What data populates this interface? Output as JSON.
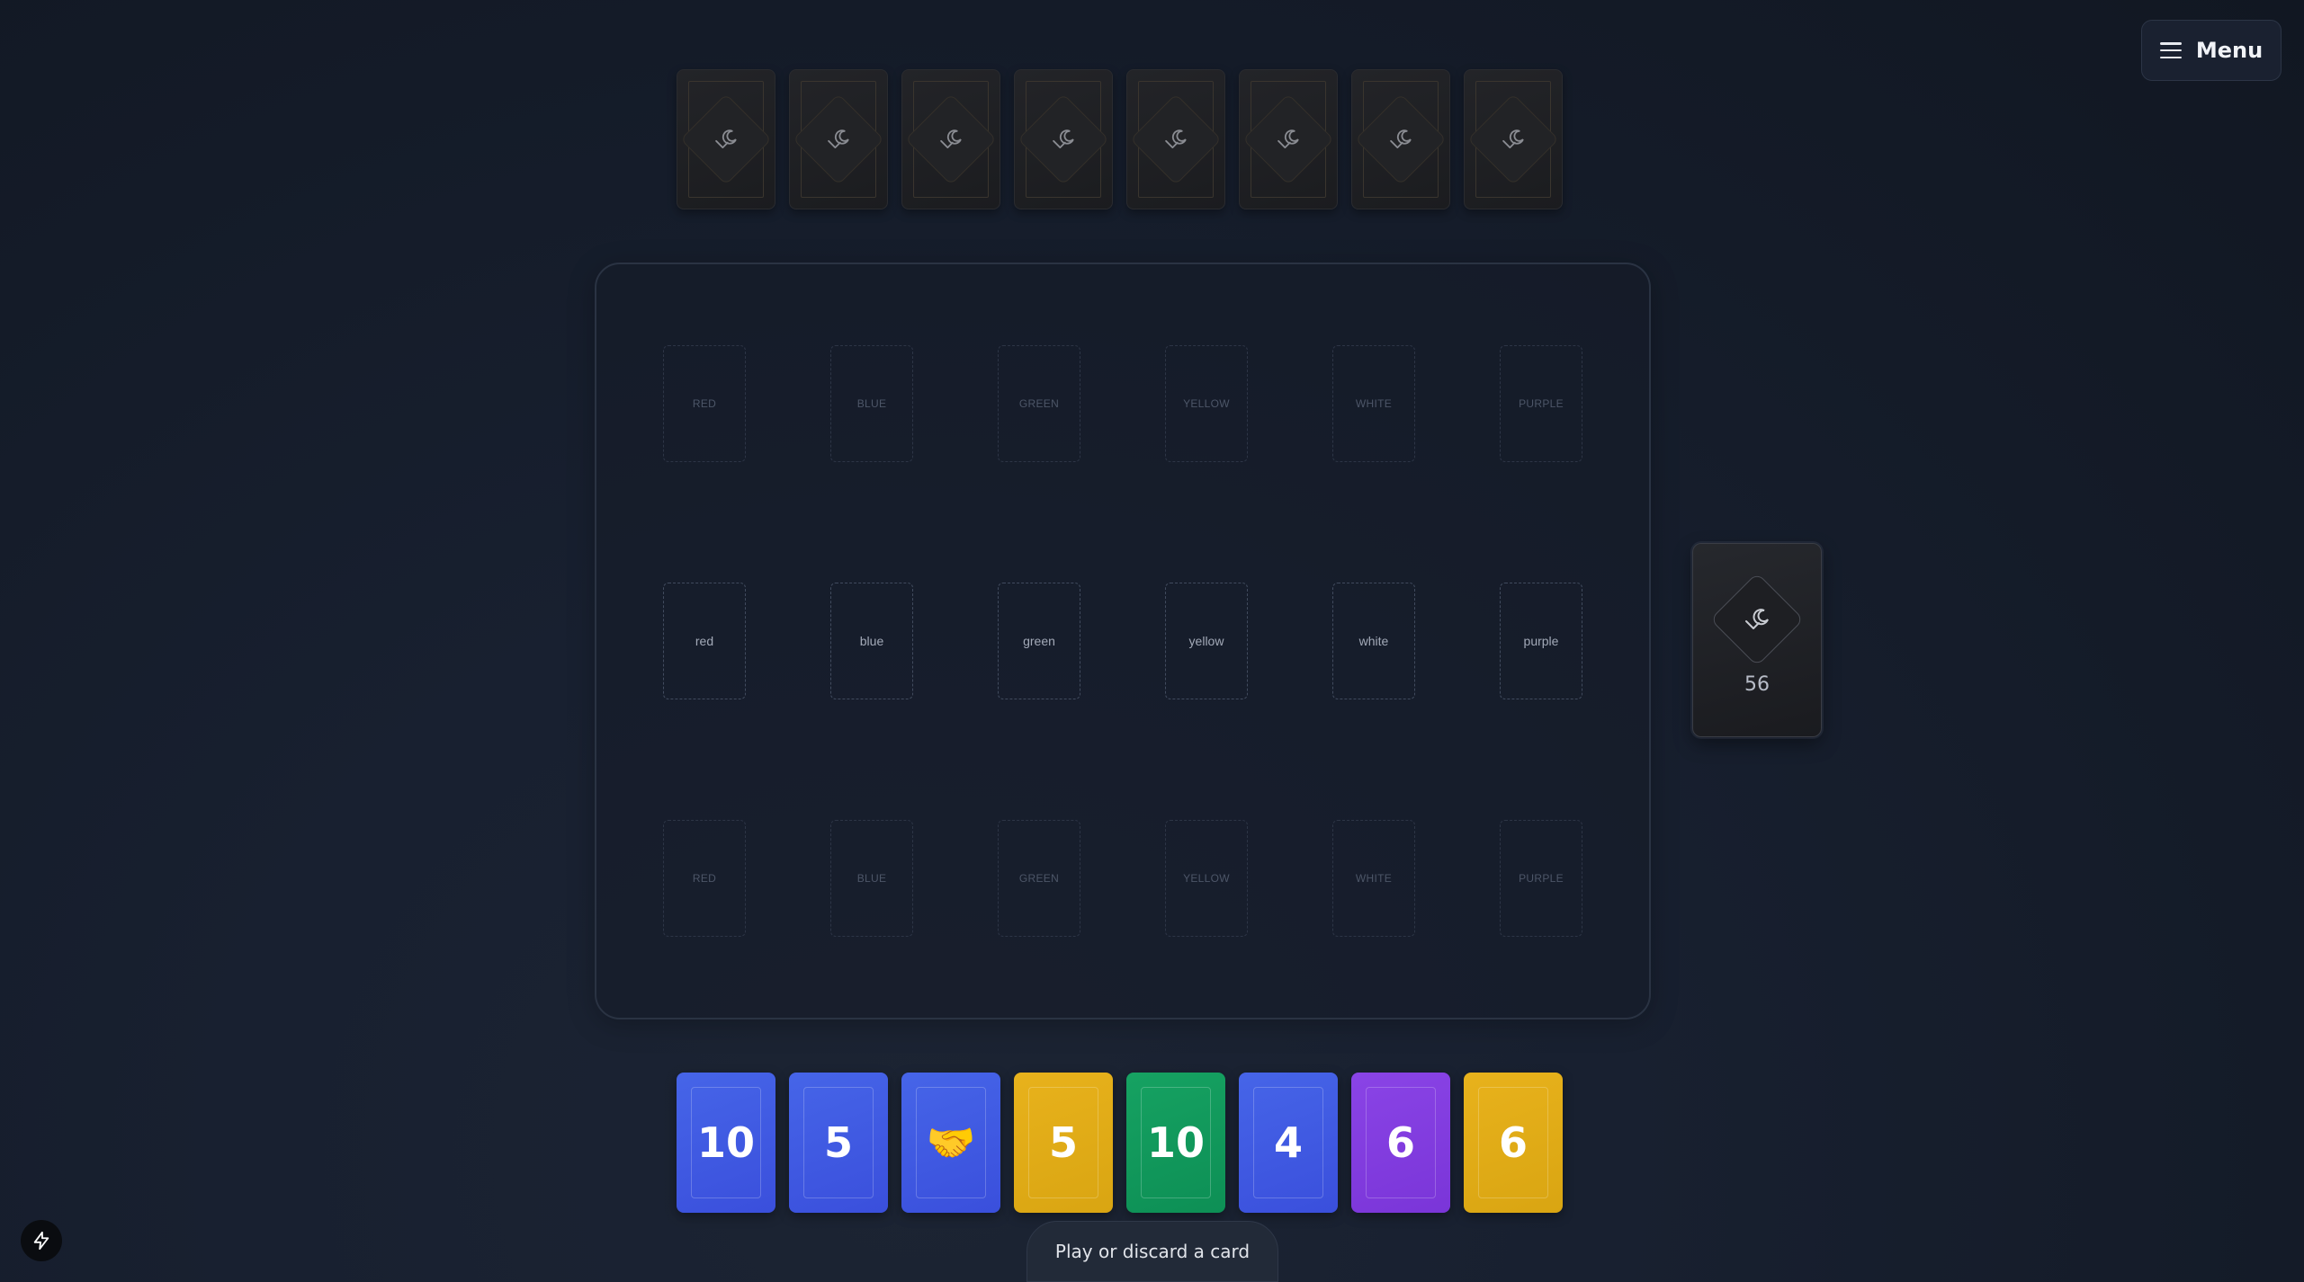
{
  "menu": {
    "label": "Menu",
    "icon": "hamburger-icon"
  },
  "opponent_hand": {
    "card_count": 8,
    "card_back_icon": "moon-diamond-icon"
  },
  "board": {
    "opponent_expeditions": [
      "RED",
      "BLUE",
      "GREEN",
      "YELLOW",
      "WHITE",
      "PURPLE"
    ],
    "discard_piles": [
      "red",
      "blue",
      "green",
      "yellow",
      "white",
      "purple"
    ],
    "player_expeditions": [
      "RED",
      "BLUE",
      "GREEN",
      "YELLOW",
      "WHITE",
      "PURPLE"
    ]
  },
  "deck": {
    "count": "56",
    "icon": "moon-diamond-icon"
  },
  "colors": {
    "blue": "#4159e3",
    "yellow": "#e0ab16",
    "green": "#11995b",
    "purple": "#8240df"
  },
  "hand": [
    {
      "color": "blue",
      "value": "10"
    },
    {
      "color": "blue",
      "value": "5"
    },
    {
      "color": "blue",
      "value": "🤝"
    },
    {
      "color": "yellow",
      "value": "5"
    },
    {
      "color": "green",
      "value": "10"
    },
    {
      "color": "blue",
      "value": "4"
    },
    {
      "color": "purple",
      "value": "6"
    },
    {
      "color": "yellow",
      "value": "6"
    }
  ],
  "status": {
    "message": "Play or discard a card"
  },
  "quick_action": {
    "icon": "lightning-bolt-icon"
  }
}
